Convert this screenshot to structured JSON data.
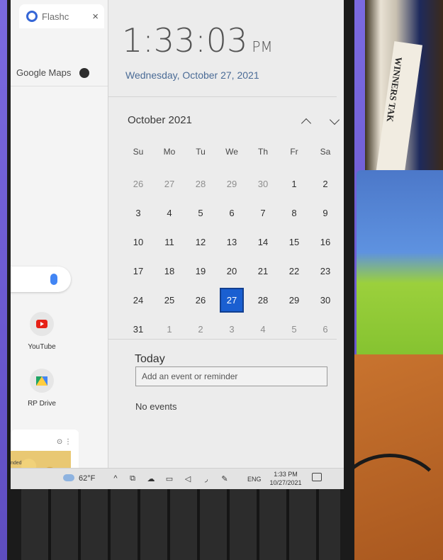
{
  "browser": {
    "tab_title": "Flashc",
    "tab_close": "×",
    "bookmark": "Google Maps",
    "shortcuts": [
      {
        "label": "YouTube"
      },
      {
        "label": "RP Drive"
      }
    ],
    "card_tag": "nded",
    "card_icons": "⊙ ⋮"
  },
  "flyout": {
    "time": "1:33:03",
    "ampm": "PM",
    "date_long": "Wednesday, October 27, 2021",
    "month_title": "October 2021",
    "weekdays": [
      "Su",
      "Mo",
      "Tu",
      "We",
      "Th",
      "Fr",
      "Sa"
    ],
    "days": [
      {
        "d": "26",
        "other": true
      },
      {
        "d": "27",
        "other": true
      },
      {
        "d": "28",
        "other": true
      },
      {
        "d": "29",
        "other": true
      },
      {
        "d": "30",
        "other": true
      },
      {
        "d": "1",
        "other": false
      },
      {
        "d": "2",
        "other": false
      },
      {
        "d": "3",
        "other": false
      },
      {
        "d": "4",
        "other": false
      },
      {
        "d": "5",
        "other": false
      },
      {
        "d": "6",
        "other": false
      },
      {
        "d": "7",
        "other": false
      },
      {
        "d": "8",
        "other": false
      },
      {
        "d": "9",
        "other": false
      },
      {
        "d": "10",
        "other": false
      },
      {
        "d": "11",
        "other": false
      },
      {
        "d": "12",
        "other": false
      },
      {
        "d": "13",
        "other": false
      },
      {
        "d": "14",
        "other": false
      },
      {
        "d": "15",
        "other": false
      },
      {
        "d": "16",
        "other": false
      },
      {
        "d": "17",
        "other": false
      },
      {
        "d": "18",
        "other": false
      },
      {
        "d": "19",
        "other": false
      },
      {
        "d": "20",
        "other": false
      },
      {
        "d": "21",
        "other": false
      },
      {
        "d": "22",
        "other": false
      },
      {
        "d": "23",
        "other": false
      },
      {
        "d": "24",
        "other": false
      },
      {
        "d": "25",
        "other": false
      },
      {
        "d": "26",
        "other": false
      },
      {
        "d": "27",
        "other": false,
        "today": true
      },
      {
        "d": "28",
        "other": false
      },
      {
        "d": "29",
        "other": false
      },
      {
        "d": "30",
        "other": false
      },
      {
        "d": "31",
        "other": false
      },
      {
        "d": "1",
        "other": true
      },
      {
        "d": "2",
        "other": true
      },
      {
        "d": "3",
        "other": true
      },
      {
        "d": "4",
        "other": true
      },
      {
        "d": "5",
        "other": true
      },
      {
        "d": "6",
        "other": true
      }
    ],
    "today_label": "Today",
    "event_placeholder": "Add an event or reminder",
    "no_events": "No events"
  },
  "taskbar": {
    "temperature": "62°F",
    "chevron": "^",
    "language": "ENG",
    "clock_time": "1:33 PM",
    "clock_date": "10/27/2021"
  },
  "scene": {
    "book_title": "WINNERS TAK"
  },
  "colors": {
    "accent": "#1a5fd1",
    "flyout_bg": "#ececec",
    "date_link": "#4a6b96"
  }
}
